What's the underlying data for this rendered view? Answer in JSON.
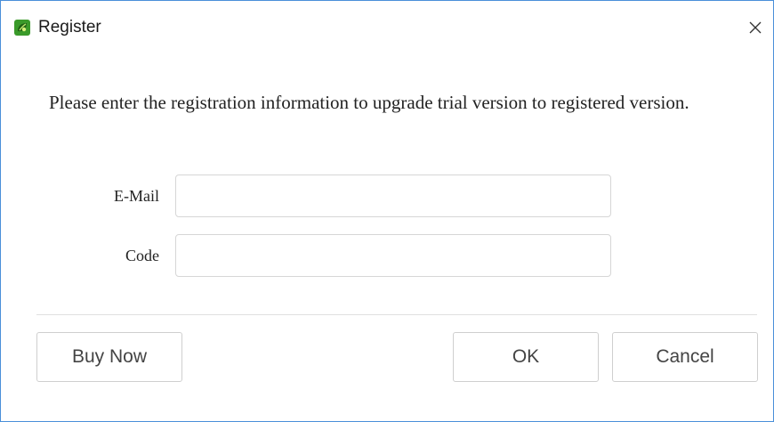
{
  "window": {
    "title": "Register",
    "app_icon": "app-leaf-icon",
    "close_icon": "close-icon",
    "close_glyph": "✕"
  },
  "dialog": {
    "message": "Please enter the registration information to upgrade trial version to registered version."
  },
  "form": {
    "email": {
      "label": "E-Mail",
      "value": ""
    },
    "code": {
      "label": "Code",
      "value": ""
    }
  },
  "buttons": {
    "buy_now": "Buy Now",
    "ok": "OK",
    "cancel": "Cancel"
  },
  "colors": {
    "window_border": "#4a90d9",
    "app_icon_green": "#3a9a2a"
  }
}
